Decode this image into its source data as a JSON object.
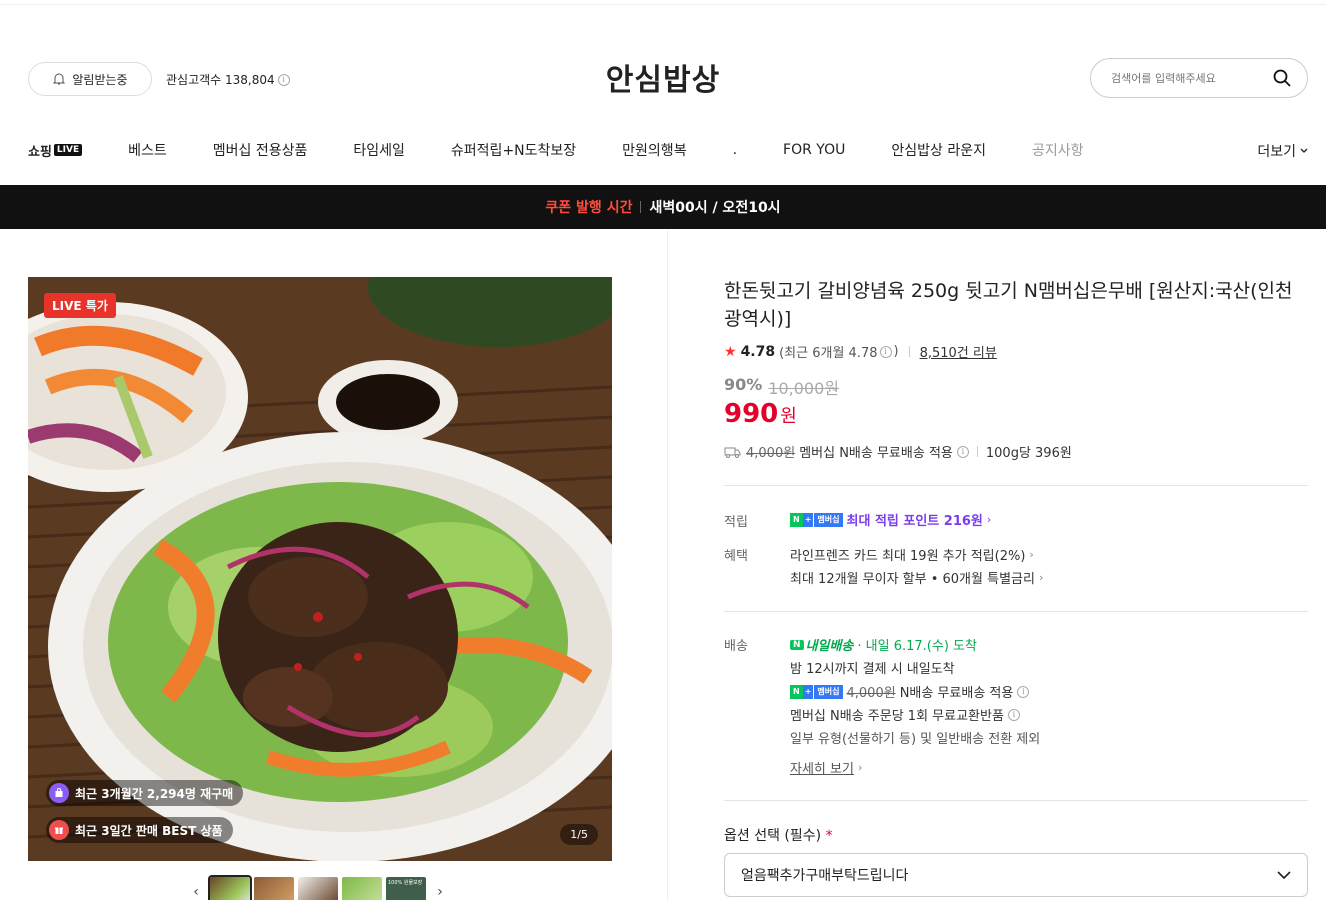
{
  "header": {
    "alarm_label": "알림받는중",
    "fans_label": "관심고객수 138,804",
    "store_title": "안심밥상",
    "search_placeholder": "검색어를 입력해주세요"
  },
  "nav": {
    "logo_text": "쇼핑",
    "logo_badge": "LIVE",
    "items": [
      "베스트",
      "멤버십 전용상품",
      "타임세일",
      "슈퍼적립+N도착보장",
      "만원의행복",
      ".",
      "FOR YOU",
      "안심밥상 라운지",
      "공지사항"
    ],
    "more_label": "더보기"
  },
  "banner": {
    "label": "쿠폰 발행 시간",
    "value": "새벽00시 / 오전10시"
  },
  "gallery": {
    "live_badge": "LIVE 특가",
    "pill_repurchase": "최근 3개월간 2,294명 재구매",
    "pill_best": "최근 3일간 판매 BEST 상품",
    "counter": "1/5",
    "thumb_text": "100% 원물보장"
  },
  "product": {
    "title": "한돈뒷고기 갈비양념육 250g 뒷고기 N맴버십은무배 [원산지:국산(인천광역시)]",
    "rating": "4.78",
    "rating_recent": "(최근 6개월 4.78",
    "rating_close": ")",
    "reviews": "8,510건 리뷰",
    "discount_rate": "90%",
    "original_price": "10,000원",
    "sale_price": "990",
    "won": "원",
    "ship_original": "4,000원",
    "ship_text": "멤버십 N배송 무료배송 적용",
    "unit_price": "100g당 396원"
  },
  "points": {
    "label": "적립",
    "badge_n": "N",
    "badge_plus": "+",
    "badge_member": "멤버십",
    "text": "최대 적립 포인트 216원"
  },
  "benefits": {
    "label": "혜택",
    "line1": "라인프렌즈 카드 최대 19원 추가 적립(2%)",
    "line2": "최대 12개월 무이자 할부 • 60개월 특별금리"
  },
  "delivery": {
    "label": "배송",
    "tomorrow_badge": "N",
    "tomorrow_label": "내일배송",
    "arrival": "· 내일 6.17.(수) 도착",
    "line1": "밤 12시까지 결제 시 내일도착",
    "ship_original": "4,000원",
    "ship_text": "N배송 무료배송 적용",
    "line3": "멤버십 N배송 주문당 1회 무료교환반품",
    "line4": "일부 유형(선물하기 등) 및 일반배송 전환 제외",
    "detail_link": "자세히 보기"
  },
  "option": {
    "label": "옵션 선택 (필수)",
    "required_mark": "*",
    "selected": "얼음팩추가구매부탁드립니다"
  },
  "colors": {
    "accent_red": "#e4002b",
    "banner_red": "#ff4d3d",
    "naver_green": "#03c75a",
    "point_purple": "#7a3df0"
  }
}
